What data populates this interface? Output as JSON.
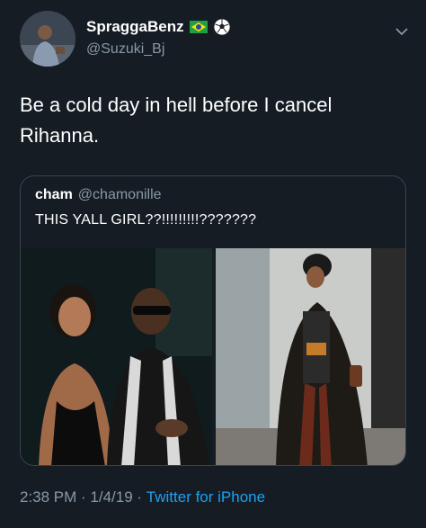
{
  "tweet": {
    "display_name": "SpraggaBenz",
    "handle": "@Suzuki_Bj",
    "text": "Be a cold day in hell before I cancel\nRihanna.",
    "time": "2:38 PM",
    "separator": " · ",
    "date": "1/4/19",
    "source": "Twitter for iPhone"
  },
  "name_icons": [
    "brazil-flag-icon",
    "soccer-ball-icon"
  ],
  "quoted_tweet": {
    "display_name": "cham",
    "handle": "@chamonille",
    "text": "THIS YALL GIRL??!!!!!!!!!???????"
  },
  "colors": {
    "background": "#151c24",
    "secondary_text": "#8899a6",
    "link": "#1da1f2",
    "border": "#38444d"
  }
}
